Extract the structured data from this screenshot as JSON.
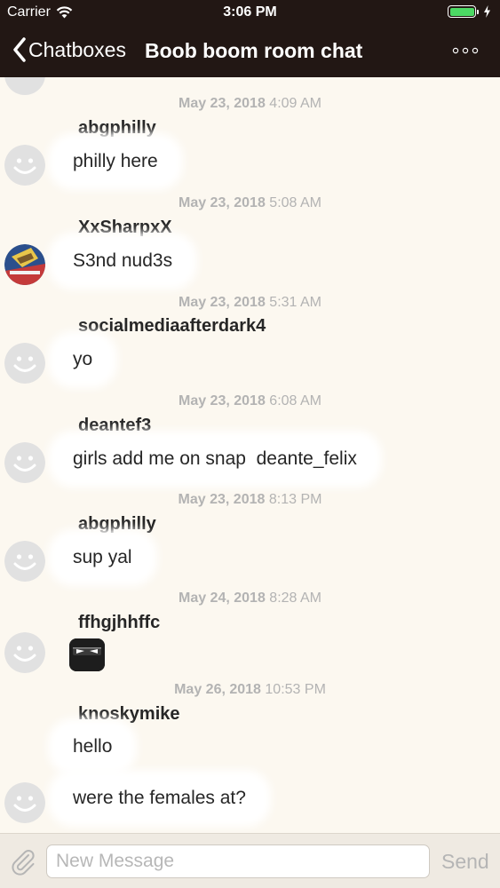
{
  "status_bar": {
    "carrier": "Carrier",
    "time": "3:06 PM"
  },
  "nav": {
    "back_label": "Chatboxes",
    "title": "Boob boom room chat",
    "more_icon": "ellipsis-icon"
  },
  "messages": [
    {
      "date": "May 23, 2018",
      "time": "4:09 AM",
      "user": "abgphilly",
      "text": "philly here",
      "avatar": "default"
    },
    {
      "date": "May 23, 2018",
      "time": "5:08 AM",
      "user": "XxSharpxX",
      "text": "S3nd nud3s",
      "avatar": "photo"
    },
    {
      "date": "May 23, 2018",
      "time": "5:31 AM",
      "user": "socialmediaafterdark4",
      "text": "yo",
      "avatar": "default"
    },
    {
      "date": "May 23, 2018",
      "time": "6:08 AM",
      "user": "deantef3",
      "text": "girls add me on snap  deante_felix",
      "avatar": "default"
    },
    {
      "date": "May 23, 2018",
      "time": "8:13 PM",
      "user": "abgphilly",
      "text": "sup yal",
      "avatar": "default"
    },
    {
      "date": "May 24, 2018",
      "time": "8:28 AM",
      "user": "ffhgjhhffc",
      "text": "",
      "sticker": "ninja-emoji",
      "avatar": "default"
    },
    {
      "date": "May 26, 2018",
      "time": "10:53 PM",
      "user": "knoskymike",
      "texts": [
        "hello",
        "were the females at?"
      ],
      "avatar": "default"
    }
  ],
  "composer": {
    "placeholder": "New Message",
    "send_label": "Send",
    "attach_icon": "paperclip-icon"
  },
  "colors": {
    "header_bg": "#221714",
    "chat_bg": "#fcf8f0",
    "timestamp": "#b3b3b3",
    "battery": "#4cd964"
  }
}
